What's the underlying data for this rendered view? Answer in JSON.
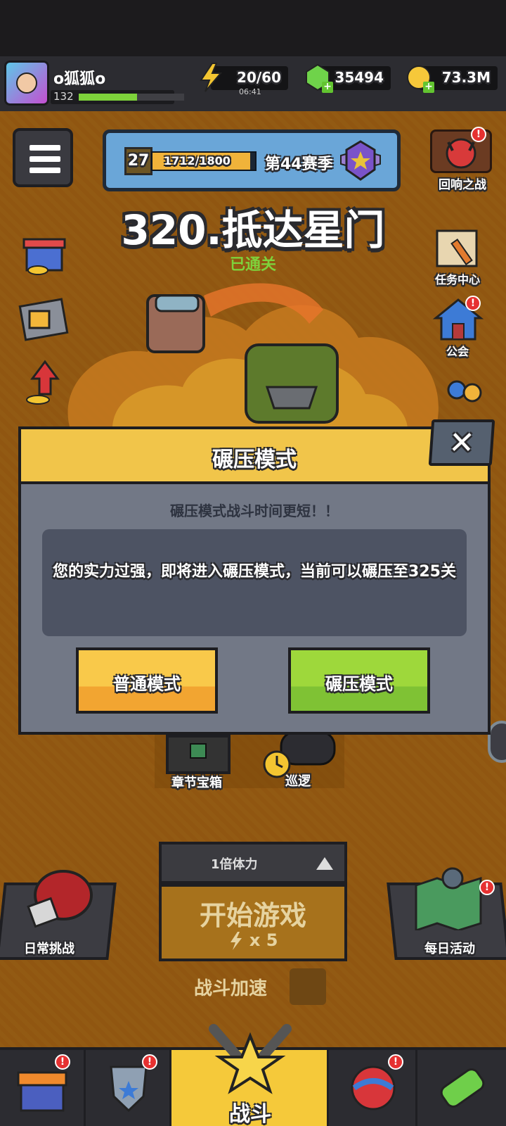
{
  "player": {
    "name": "o狐狐o",
    "level": "132",
    "xp_fill": 0.55
  },
  "resources": {
    "energy": {
      "value": "20/60",
      "timer": "06:41"
    },
    "gems": {
      "value": "35494"
    },
    "coins": {
      "value": "73.3M"
    }
  },
  "season": {
    "level": "27",
    "xp": "1712/1800",
    "xp_fraction": 0.951,
    "name": "第44赛季"
  },
  "top_right": {
    "echo_battle": "回响之战"
  },
  "stage": {
    "title": "320.抵达星门",
    "status": "已通关"
  },
  "side_right": {
    "tasks": "任务中心",
    "guild": "公会"
  },
  "modal": {
    "title": "碾压模式",
    "close_icon": "✕",
    "subtitle": "碾压模式战斗时间更短！！",
    "message": "您的实力过强，即将进入碾压模式，当前可以碾压至325关",
    "normal_button": "普通模式",
    "crush_button": "碾压模式"
  },
  "lower": {
    "chapter_chest": "章节宝箱",
    "patrol": "巡逻",
    "multiplier": "1倍体力",
    "start_game": "开始游戏",
    "start_cost": "x 5",
    "daily_challenge": "日常挑战",
    "daily_activity": "每日活动",
    "battle_speed": "战斗加速"
  },
  "nav": {
    "battle": "战斗",
    "badge": "!"
  },
  "colors": {
    "accent_yellow": "#f1c54a",
    "accent_green": "#7ed23b",
    "modal_gray": "#727886",
    "badge_red": "#e63131"
  }
}
